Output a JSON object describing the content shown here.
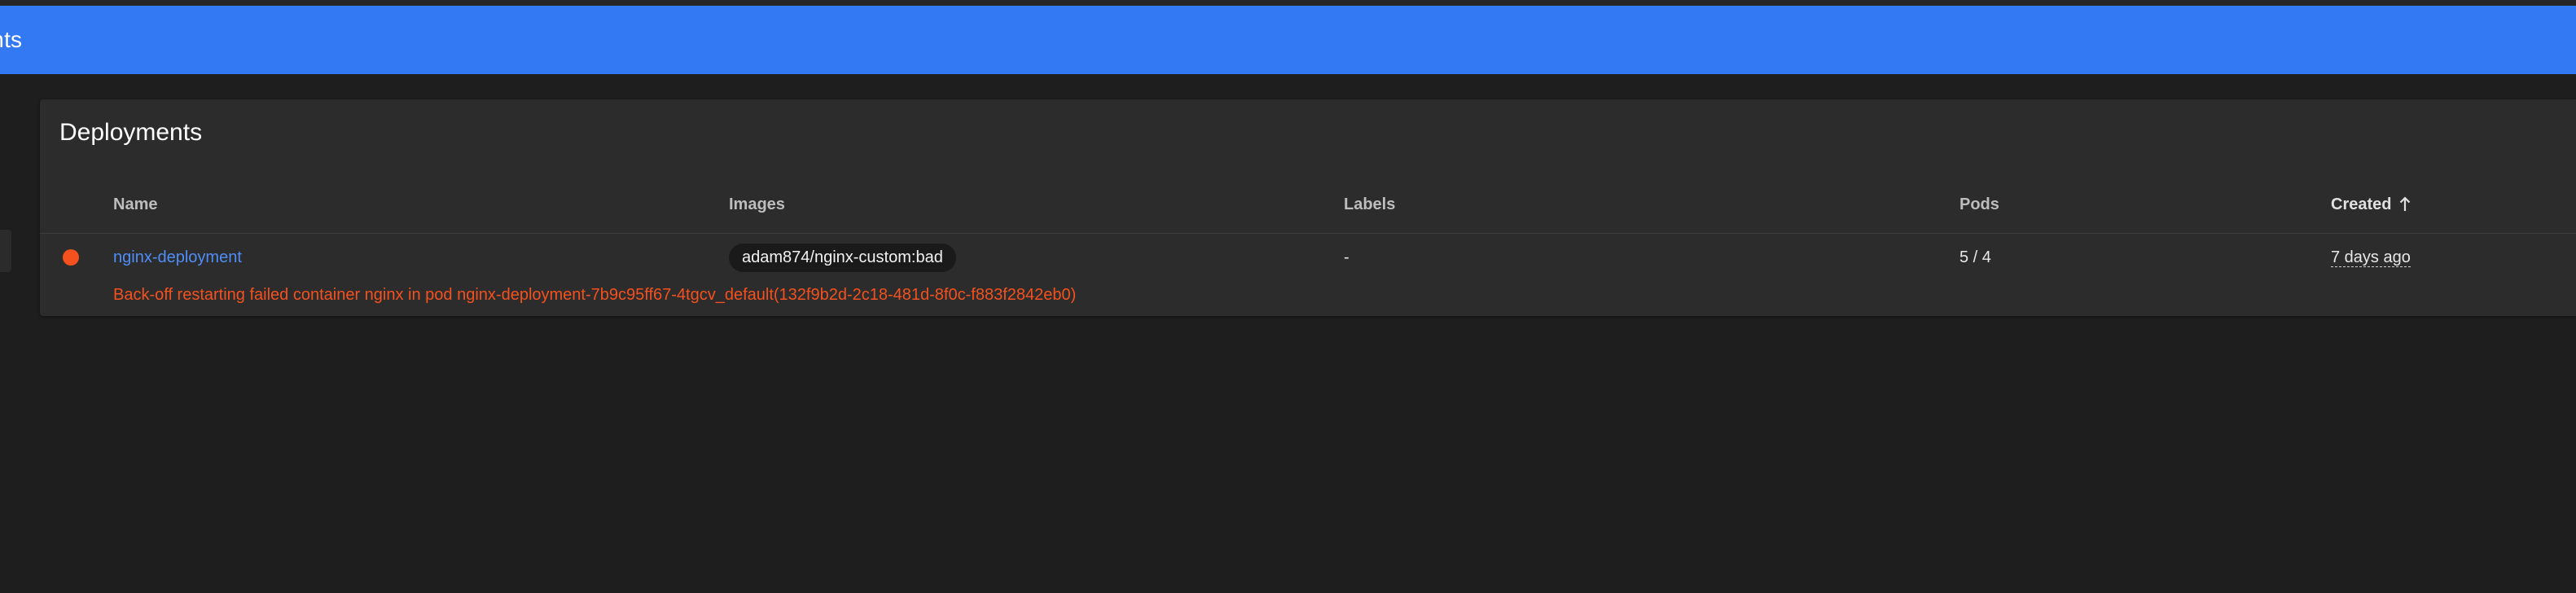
{
  "appbar": {
    "title": "ments"
  },
  "card": {
    "title": "Deployments",
    "columns": {
      "name": "Name",
      "images": "Images",
      "labels": "Labels",
      "pods": "Pods",
      "created": "Created"
    },
    "rows": [
      {
        "status": "error",
        "name": "nginx-deployment",
        "image": "adam874/nginx-custom:bad",
        "labels": "-",
        "pods": "5 / 4",
        "created": "7 days ago",
        "error_message": "Back-off restarting failed container nginx in pod nginx-deployment-7b9c95ff67-4tgcv_default(132f9b2d-2c18-481d-8f0c-f883f2842eb0)"
      }
    ]
  },
  "colors": {
    "appbar": "#3379f3",
    "background": "#1e1e1e",
    "card": "#2c2c2c",
    "error": "#f4511e",
    "link": "#4f8df7"
  },
  "icons": {
    "status": "status-error-dot",
    "sort": "arrow-up-icon"
  }
}
